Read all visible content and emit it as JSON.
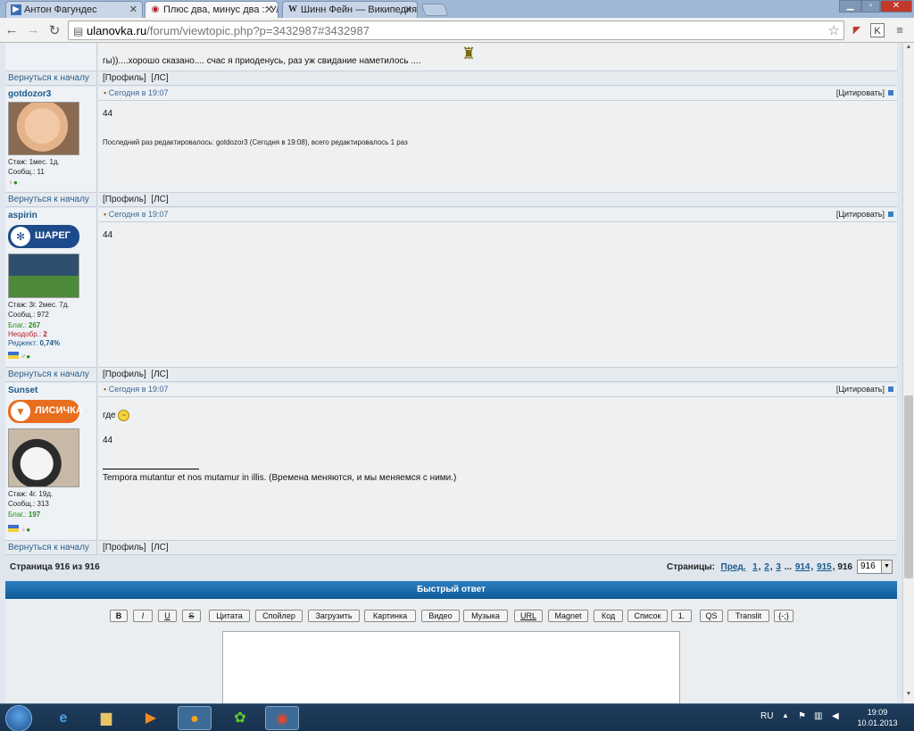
{
  "browser": {
    "tabs": [
      {
        "title": "Антон Фагундес",
        "icon": "bookmark-icon"
      },
      {
        "title": "Плюс два, минус два :: Ул",
        "icon": "ulanovka-icon",
        "active": true
      },
      {
        "title": "Шинн Фейн — Википедия",
        "icon": "wikipedia-icon"
      }
    ],
    "url_host": "ulanovka.ru",
    "url_path": "/forum/viewtopic.php?p=3432987#3432987"
  },
  "prev_post": {
    "text": "гы))....хорошо сказано.... счас я приоденусь, раз уж свидание наметилось ...."
  },
  "nav": {
    "back_to_top": "Вернуться к началу",
    "profile": "[Профиль]",
    "pm": "[ЛС]"
  },
  "posts": [
    {
      "username": "gotdozor3",
      "date": "Сегодня в 19:07",
      "quote": "[Цитировать]",
      "stats": [
        "Стаж: 1мес. 1д.",
        "Сообщ.: 11"
      ],
      "body": "44",
      "edit_note": "Последний раз редактировалось: gotdozor3 (Сегодня в 19:08), всего редактировалось 1 раз"
    },
    {
      "username": "aspirin",
      "date": "Сегодня в 19:07",
      "quote": "[Цитировать]",
      "rank": "ШАРЕГ",
      "stats": [
        "Стаж: 3г. 2мес. 7д.",
        "Сообщ.: 972"
      ],
      "thanks_label": "Благ.:",
      "thanks": "267",
      "unlikes_label": "Неодобр.:",
      "unlikes": "2",
      "ratio_label": "Реджект:",
      "ratio": "0,74%",
      "body": "44"
    },
    {
      "username": "Sunset",
      "date": "Сегодня в 19:07",
      "quote": "[Цитировать]",
      "rank": "ЛИСИЧКА",
      "stats": [
        "Стаж: 4г. 19д.",
        "Сообщ.: 313"
      ],
      "thanks_label": "Благ.:",
      "thanks": "197",
      "body_line1": "где",
      "body_line2": "44",
      "signature": "Tempora mutantur et nos mutamur in illis. (Времена меняются, и мы меняемся с ними.)"
    }
  ],
  "pagination": {
    "info": "Страница 916 из 916",
    "label": "Страницы:",
    "prev": "Пред.",
    "p1": "1",
    "p2": "2",
    "p3": "3",
    "dots": "...",
    "p914": "914",
    "p915": "915",
    "current": "916",
    "select_value": "916"
  },
  "quick_reply": {
    "title": "Быстрый ответ",
    "buttons": [
      "B",
      "I",
      "U",
      "S",
      "Цитата",
      "Спойлер",
      "Загрузить",
      "Картинка",
      "Видео",
      "Музыка",
      "URL",
      "Magnet",
      "Код",
      "Список",
      "1.",
      "QS",
      "Translit",
      "{-;}"
    ]
  },
  "taskbar": {
    "lang": "RU",
    "time": "19:09",
    "date": "10.01.2013"
  }
}
